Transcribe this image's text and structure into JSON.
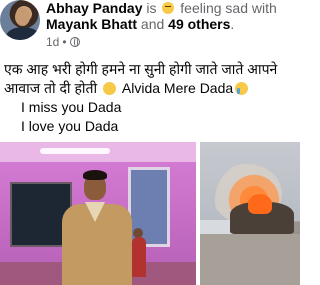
{
  "header": {
    "author_name": "Abhay Panday",
    "is_text": "is",
    "feeling_text": "feeling sad",
    "with_text": "with",
    "tagged_name": "Mayank Bhatt",
    "and_text": "and",
    "others_text": "49 others",
    "period": ".",
    "time": "1d",
    "dot": "•"
  },
  "post": {
    "line1": "एक आह भरी होगी हमने ना सुनी होगी जाते जाते आपने",
    "line2_start": "आवाज तो दी होती",
    "line2_end": "Alvida Mere Dada",
    "line3": "I miss you Dada",
    "line4": "I love you Dada"
  },
  "icons": {
    "feeling": "sad-face-icon",
    "privacy": "globe-icon",
    "emoji1": "pensive-face-icon",
    "emoji2": "crying-face-icon"
  }
}
